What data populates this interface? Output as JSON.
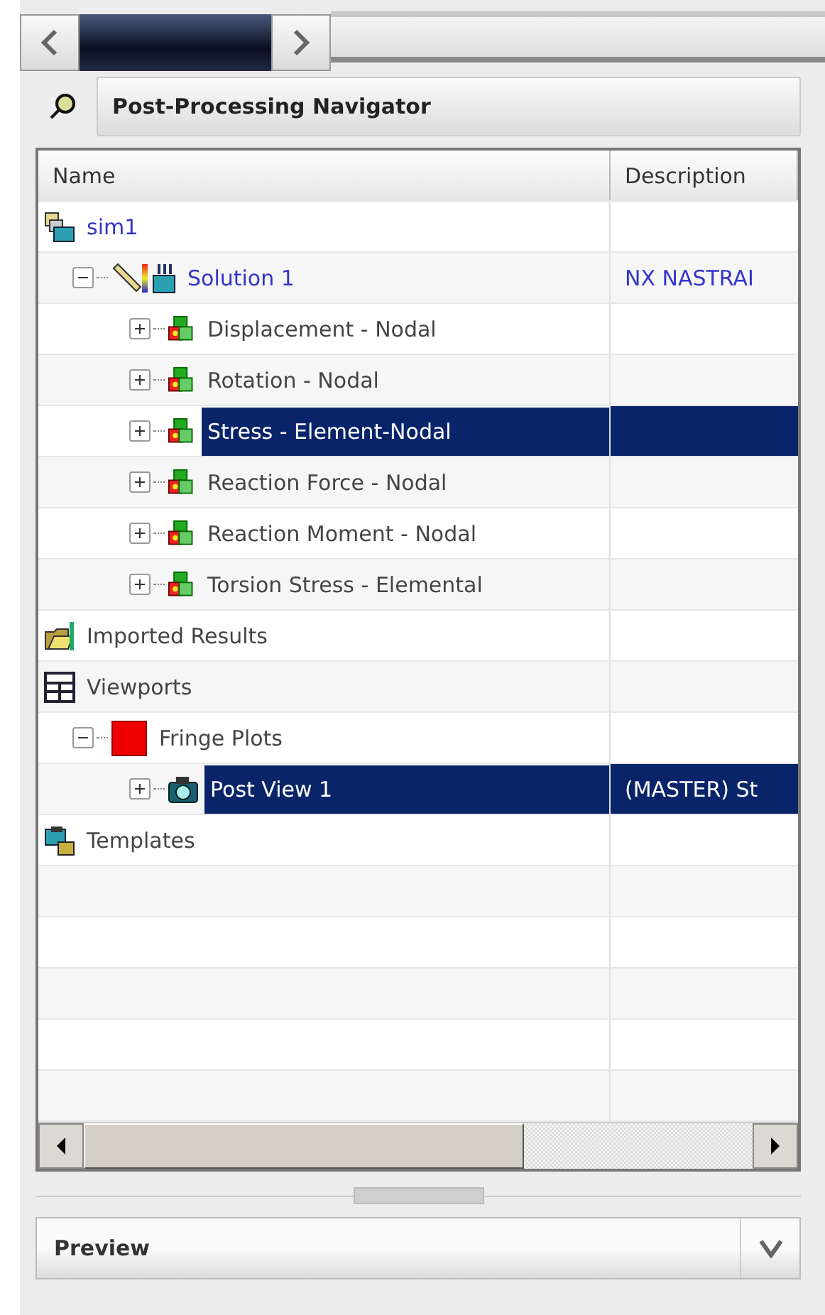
{
  "navigator": {
    "title": "Post-Processing Navigator"
  },
  "columns": [
    "Name",
    "Description"
  ],
  "tree": [
    {
      "label": "sim1",
      "kind": "sim",
      "active": true,
      "selected": false,
      "children": [
        {
          "label": "Solution 1",
          "description": "NX NASTRAI",
          "kind": "solution",
          "active": true,
          "selected": false,
          "expanded": true,
          "children": [
            {
              "label": "Displacement - Nodal",
              "kind": "result",
              "active": false,
              "selected": false,
              "expanded": false
            },
            {
              "label": "Rotation - Nodal",
              "kind": "result",
              "active": false,
              "selected": false,
              "expanded": false
            },
            {
              "label": "Stress - Element-Nodal",
              "kind": "result",
              "active": false,
              "selected": true,
              "expanded": false
            },
            {
              "label": "Reaction Force - Nodal",
              "kind": "result",
              "active": false,
              "selected": false,
              "expanded": false
            },
            {
              "label": "Reaction Moment - Nodal",
              "kind": "result",
              "active": false,
              "selected": false,
              "expanded": false
            },
            {
              "label": "Torsion Stress - Elemental",
              "kind": "result",
              "active": false,
              "selected": false,
              "expanded": false
            }
          ]
        }
      ]
    },
    {
      "label": "Imported Results",
      "kind": "folder",
      "active": false,
      "selected": false
    },
    {
      "label": "Viewports",
      "kind": "viewports",
      "active": false,
      "selected": false,
      "children": [
        {
          "label": "Fringe Plots",
          "kind": "fringe",
          "active": false,
          "selected": false,
          "expanded": true,
          "children": [
            {
              "label": "Post View 1",
              "description": "(MASTER) St",
              "kind": "camera",
              "active": false,
              "selected": true,
              "expanded": false
            }
          ]
        }
      ]
    },
    {
      "label": "Templates",
      "kind": "templates",
      "active": false,
      "selected": false
    }
  ],
  "preview": {
    "title": "Preview"
  }
}
